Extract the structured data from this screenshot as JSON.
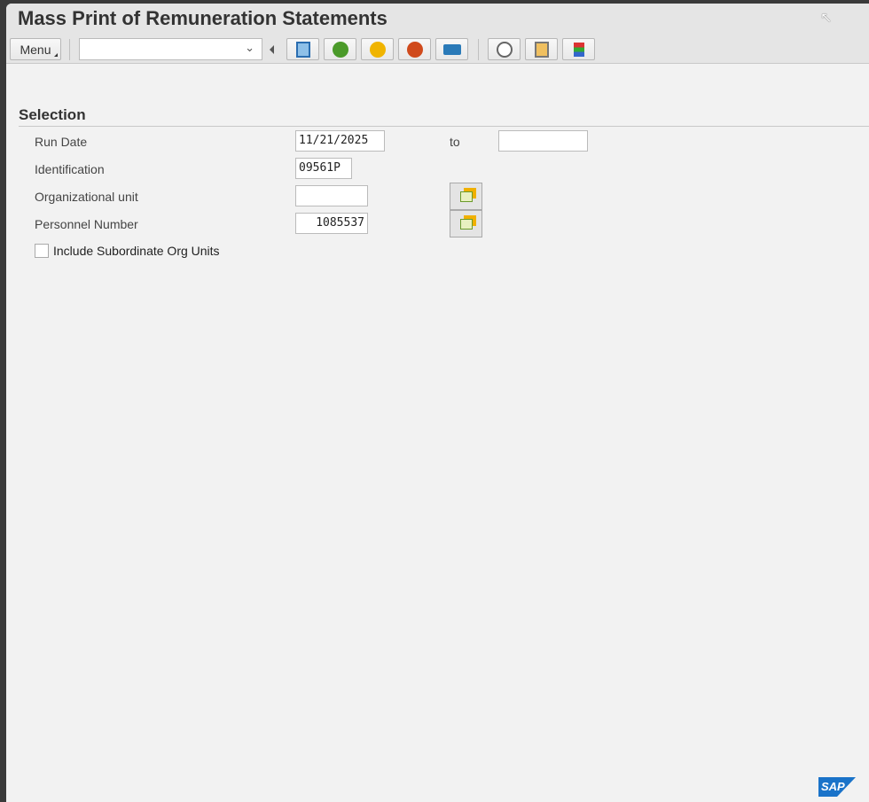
{
  "title": "Mass Print of Remuneration Statements",
  "toolbar": {
    "menu_label": "Menu",
    "command_value": ""
  },
  "section_title": "Selection",
  "fields": {
    "run_date": {
      "label": "Run Date",
      "value": "11/21/2025",
      "to_label": "to",
      "to_value": ""
    },
    "identification": {
      "label": "Identification",
      "value": "09561P"
    },
    "org_unit": {
      "label": "Organizational unit",
      "value": ""
    },
    "personnel_number": {
      "label": "Personnel Number",
      "value": "1085537"
    }
  },
  "checkbox": {
    "label": "Include Subordinate Org Units",
    "checked": false
  },
  "logo": "SAP"
}
